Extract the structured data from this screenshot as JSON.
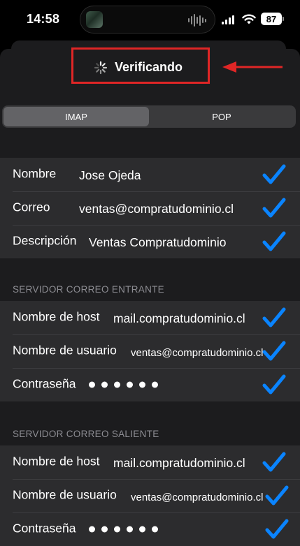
{
  "status_bar": {
    "time": "14:58",
    "battery": "87"
  },
  "nav": {
    "status_label": "Verificando"
  },
  "segmented": {
    "options": [
      "IMAP",
      "POP"
    ],
    "selected": "IMAP"
  },
  "account": {
    "rows": [
      {
        "label": "Nombre",
        "value": "Jose Ojeda"
      },
      {
        "label": "Correo",
        "value": "ventas@compratudominio.cl"
      },
      {
        "label": "Descripción",
        "value": "Ventas Compratudominio"
      }
    ]
  },
  "incoming": {
    "header": "SERVIDOR CORREO ENTRANTE",
    "host_label": "Nombre de host",
    "host_value": "mail.compratudominio.cl",
    "user_label": "Nombre de usuario",
    "user_value": "ventas@compratudominio.cl",
    "password_label": "Contraseña"
  },
  "outgoing": {
    "header": "SERVIDOR CORREO SALIENTE",
    "host_label": "Nombre de host",
    "host_value": "mail.compratudominio.cl",
    "user_label": "Nombre de usuario",
    "user_value": "ventas@compratudominio.cl",
    "password_label": "Contraseña"
  },
  "colors": {
    "checkmark": "#0a84ff",
    "highlight": "#e02626",
    "cell_background": "#2c2c2e",
    "sheet_background": "#1c1c1e"
  }
}
